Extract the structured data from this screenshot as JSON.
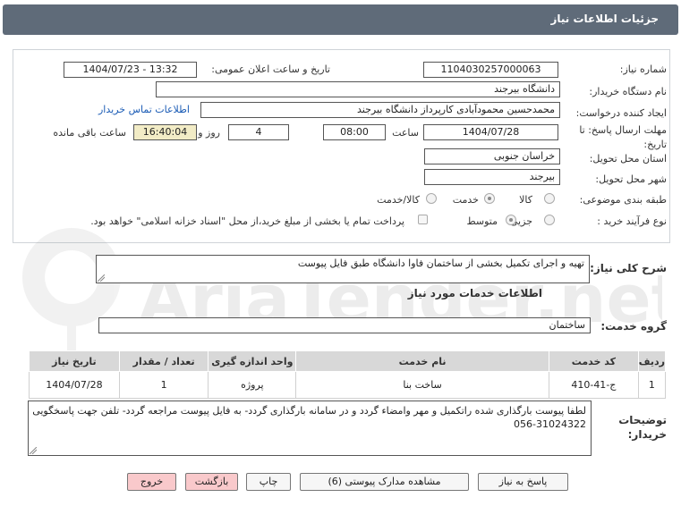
{
  "header": {
    "title": "جزئیات اطلاعات نیاز"
  },
  "form": {
    "need_number_label": "شماره نیاز:",
    "need_number": "1104030257000063",
    "announce_label": "تاریخ و ساعت اعلان عمومی:",
    "announce_value": "1404/07/23 - 13:32",
    "buyer_org_label": "نام دستگاه خریدار:",
    "buyer_org": "دانشگاه بیرجند",
    "requester_label": "ایجاد کننده درخواست:",
    "requester": "محمدحسین محمودآبادی کارپرداز دانشگاه بیرجند",
    "contact_link": "اطلاعات تماس خریدار",
    "deadline_label": "مهلت ارسال پاسخ: تا تاریخ:",
    "deadline_date": "1404/07/28",
    "time_label": "ساعت",
    "deadline_time": "08:00",
    "days": "4",
    "days_label": "روز و",
    "remaining_time": "16:40:04",
    "remaining_label": "ساعت باقی مانده",
    "province_label": "استان محل تحویل:",
    "province": "خراسان جنوبی",
    "city_label": "شهر محل تحویل:",
    "city": "بیرجند",
    "category_label": "طبقه بندی موضوعی:",
    "category_options": [
      "کالا",
      "خدمت",
      "کالا/خدمت"
    ],
    "category_selected": "خدمت",
    "purchase_type_label": "نوع فرآیند خرید :",
    "purchase_options": [
      "جزیی",
      "متوسط"
    ],
    "purchase_selected": "متوسط",
    "payment_note": "پرداخت تمام یا بخشی از مبلغ خرید،از محل \"اسناد خزانه اسلامی\" خواهد بود."
  },
  "summary": {
    "label": "شرح کلی نیاز:",
    "value": "تهیه و اجرای تکمیل بخشی از ساختمان فاوا دانشگاه طبق فایل پیوست"
  },
  "services": {
    "section_title": "اطلاعات خدمات مورد نیاز",
    "group_label": "گروه خدمت:",
    "group_value": "ساختمان",
    "columns": [
      "ردیف",
      "کد خدمت",
      "نام خدمت",
      "واحد اندازه گیری",
      "تعداد / مقدار",
      "تاریخ نیاز"
    ],
    "rows": [
      {
        "row": "1",
        "code": "ج-41-410",
        "name": "ساخت بنا",
        "unit": "پروژه",
        "qty": "1",
        "date": "1404/07/28"
      }
    ]
  },
  "notes": {
    "label": "توضیحات خریدار:",
    "value": "لطفا پیوست بارگذاری شده راتکمیل و مهر وامضاء گردد و در سامانه بارگذاری گردد- به فایل پیوست مراجعه گردد- تلفن جهت پاسخگویی 31024322-056"
  },
  "buttons": {
    "reply": "پاسخ به نیاز",
    "attachments": "مشاهده مدارک پیوستی (6)",
    "print": "چاپ",
    "back": "بازگشت",
    "exit": "خروج"
  },
  "watermark": {
    "text": "AriaTender.net"
  },
  "colors": {
    "titlebar": "#5f6b79",
    "remaining_bg": "#f2ecc6",
    "exit_button": "#f9c9cb",
    "link": "#1a5bb5"
  }
}
